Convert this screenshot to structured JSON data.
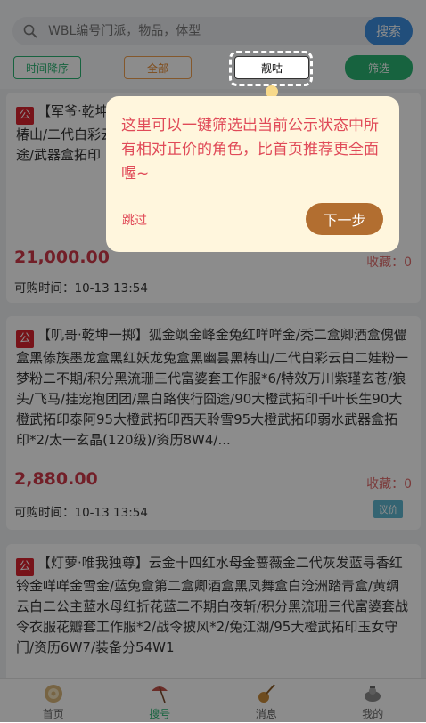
{
  "search": {
    "placeholder": "WBL编号门派，物品，体型",
    "button_label": "搜索"
  },
  "filters": {
    "sort_label": "时间降序",
    "all_label": "全部",
    "liang_label": "靓咕",
    "filter_label": "筛选"
  },
  "listings": [
    {
      "tag": "公",
      "title": "【军爷·乾坤一掷】金莲台盒红六七白盒/蓝金鹿金莲/白龙隐黑椿山/二代白彩云白工作服*7战令衣服/系/三山四海三/武器盒拓印途/武器盒拓印",
      "price": "21,000.00",
      "fav": "收藏：0",
      "time": "可购时间：10-13 13:54",
      "badge": ""
    },
    {
      "tag": "公",
      "title": "【叽哥·乾坤一掷】狐金飒金峰金兔红咩咩金/秃二盒卿酒盒傀儡盒黑傣族墨龙盒黑红妖龙兔盒黑幽昙黑椿山/二代白彩云白二娃粉一梦粉二不期/积分黑流珊三代富婆套工作服*6/特效万川紫瑾玄苍/狼头/飞马/挂宠抱团团/黑白路侠行囧途/90大橙武拓印千叶长生90大橙武拓印泰阿95大橙武拓印西天聆雪95大橙武拓印弱水武器盒拓印*2/太一玄晶(120级)/资历8W4/...",
      "price": "2,880.00",
      "fav": "收藏：0",
      "time": "可购时间：10-13 13:54",
      "badge": "议价"
    },
    {
      "tag": "公",
      "title": "【灯萝·唯我独尊】云金十四红水母金蔷薇金二代灰发蓝寻香红铃金咩咩金雪金/蓝兔盒第二盒卿酒盒黑凤舞盒白沧洲踏青盒/黄绸云白二公主蓝水母红折花蓝二不期白夜斩/积分黑流珊三代富婆套战令衣服花瓣套工作服*2/战令披风*2/兔江湖/95大橙武拓印玉女守门/资历6W7/装备分54W1",
      "price": "",
      "fav": "",
      "time": "",
      "badge": ""
    }
  ],
  "tabs": [
    {
      "label": "首页",
      "icon": "home-coin-icon"
    },
    {
      "label": "搜号",
      "icon": "umbrella-icon"
    },
    {
      "label": "消息",
      "icon": "pipa-icon"
    },
    {
      "label": "我的",
      "icon": "profile-icon"
    }
  ],
  "guide": {
    "text": "这里可以一键筛选出当前公示状态中所有相对正价的角色，比首页推荐更全面喔~",
    "skip_label": "跳过",
    "next_label": "下一步"
  },
  "colors": {
    "accent_green": "#2bb573",
    "price_red": "#d03a4a",
    "search_blue": "#3d8fe0",
    "next_brown": "#b26e30"
  }
}
